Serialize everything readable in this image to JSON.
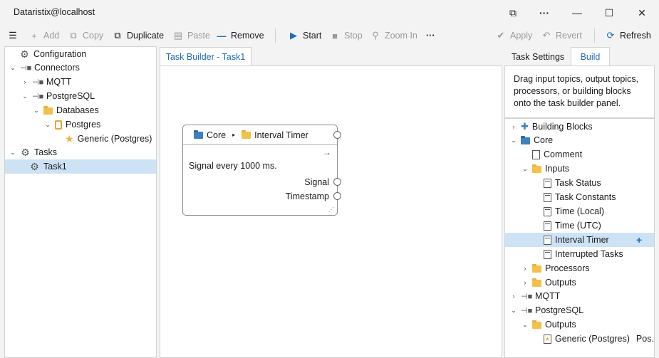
{
  "window": {
    "title": "Dataristix@localhost",
    "controls": [
      "restore-icon",
      "more-icon",
      "minimize-icon",
      "maximize-icon",
      "close-icon"
    ]
  },
  "toolbar": {
    "add": "Add",
    "copy": "Copy",
    "duplicate": "Duplicate",
    "paste": "Paste",
    "remove": "Remove",
    "start": "Start",
    "stop": "Stop",
    "zoom_in": "Zoom In",
    "more": "···",
    "apply": "Apply",
    "revert": "Revert",
    "refresh": "Refresh"
  },
  "left_tree": {
    "configuration": "Configuration",
    "connectors": "Connectors",
    "mqtt": "MQTT",
    "postgresql": "PostgreSQL",
    "databases": "Databases",
    "postgres": "Postgres",
    "generic": "Generic (Postgres)",
    "tasks": "Tasks",
    "task1": "Task1"
  },
  "center": {
    "tab": "Task Builder - Task1",
    "node": {
      "crumb_parent": "Core",
      "crumb_child": "Interval Timer",
      "description": "Signal every 1000 ms.",
      "out_signal": "Signal",
      "out_timestamp": "Timestamp",
      "arrow": "→"
    }
  },
  "right": {
    "tabs": {
      "settings": "Task Settings",
      "build": "Build"
    },
    "hint": "Drag input topics, output topics, processors, or building blocks onto the task builder panel.",
    "tree": {
      "building_blocks": "Building Blocks",
      "core": "Core",
      "comment": "Comment",
      "inputs": "Inputs",
      "task_status": "Task Status",
      "task_constants": "Task Constants",
      "time_local": "Time (Local)",
      "time_utc": "Time (UTC)",
      "interval_timer": "Interval Timer",
      "interrupted_tasks": "Interrupted Tasks",
      "processors": "Processors",
      "outputs": "Outputs",
      "mqtt": "MQTT",
      "postgresql": "PostgreSQL",
      "pg_outputs": "Outputs",
      "generic": "Generic (Postgres)",
      "generic_suffix": "Pos..."
    }
  },
  "colors": {
    "accent": "#1e6bb8",
    "selection": "#cde3f5",
    "folder": "#f3c14b",
    "core_folder": "#3f7fbf"
  }
}
